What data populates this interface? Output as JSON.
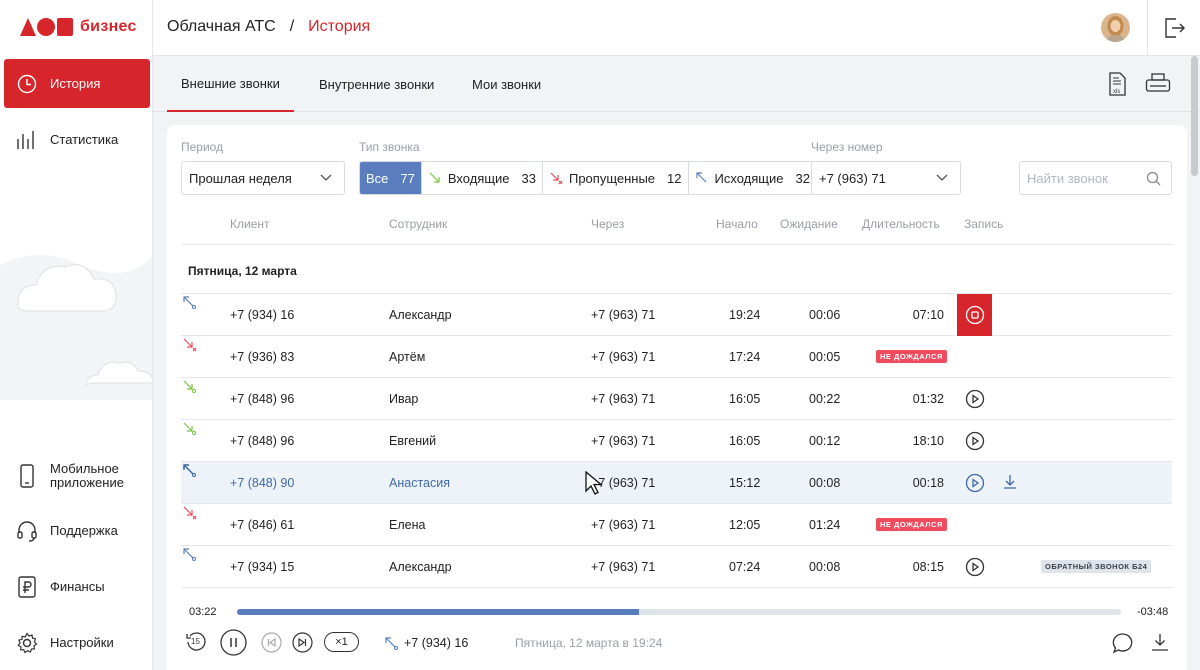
{
  "brand": {
    "logo_text": "бизнес",
    "accent": "#d7252c"
  },
  "sidebar": {
    "items": [
      {
        "label": "История",
        "icon": "clock-icon",
        "active": true
      },
      {
        "label": "Статистика",
        "icon": "bars-chart-icon"
      },
      {
        "label": "Мобильное приложение",
        "icon": "phone-icon"
      },
      {
        "label": "Поддержка",
        "icon": "headset-icon"
      },
      {
        "label": "Финансы",
        "icon": "ruble-icon"
      },
      {
        "label": "Настройки",
        "icon": "gear-icon"
      }
    ]
  },
  "header": {
    "section": "Облачная АТС",
    "separator": "/",
    "page": "История"
  },
  "tabs": [
    "Внешние звонки",
    "Внутренние звонки",
    "Мои звонки"
  ],
  "tools": {
    "export_icon": "xls-export-icon",
    "print_icon": "printer-icon"
  },
  "filters": {
    "period_label": "Период",
    "period_value": "Прошлая неделя",
    "type_label": "Тип звонка",
    "types": [
      {
        "label": "Все",
        "count": "77",
        "active": true
      },
      {
        "label": "Входящие",
        "count": "33"
      },
      {
        "label": "Пропущенные",
        "count": "12"
      },
      {
        "label": "Исходящие",
        "count": "32"
      }
    ],
    "via_label": "Через номер",
    "via_value": "+7 (963) 71",
    "search_placeholder": "Найти звонок"
  },
  "table": {
    "headers": [
      "Клиент",
      "Сотрудник",
      "Через",
      "Начало",
      "Ожидание",
      "Длительность",
      "Запись"
    ],
    "group": "Пятница, 12 марта",
    "rows": [
      {
        "dir": "outgoing",
        "client": "+7 (934) 16",
        "employee": "Александр",
        "via": "+7 (963) 71",
        "start": "19:24",
        "wait": "00:06",
        "duration": "07:10",
        "record": "stop"
      },
      {
        "dir": "missed",
        "client": "+7 (936) 83",
        "employee": "Артём",
        "via": "+7 (963) 71",
        "start": "17:24",
        "wait": "00:05",
        "badge": "НЕ ДОЖДАЛСЯ"
      },
      {
        "dir": "incoming",
        "client": "+7 (848) 96",
        "employee": "Ивар",
        "via": "+7 (963) 71",
        "start": "16:05",
        "wait": "00:22",
        "duration": "01:32",
        "record": "play"
      },
      {
        "dir": "incoming",
        "client": "+7 (848) 96",
        "employee": "Евгений",
        "via": "+7 (963) 71",
        "start": "16:05",
        "wait": "00:12",
        "duration": "18:10",
        "record": "play"
      },
      {
        "dir": "outgoing",
        "client": "+7 (848) 90",
        "employee": "Анастасия",
        "via": "+7 (963) 71",
        "start": "15:12",
        "wait": "00:08",
        "duration": "00:18",
        "record": "play",
        "download": true,
        "highlight": true
      },
      {
        "dir": "missed",
        "client": "+7 (846) 61",
        "employee": "Елена",
        "via": "+7 (963) 71",
        "start": "12:05",
        "wait": "01:24",
        "badge": "НЕ ДОЖДАЛСЯ"
      },
      {
        "dir": "outgoing",
        "client": "+7 (934) 15",
        "employee": "Александр",
        "via": "+7 (963) 71",
        "start": "07:24",
        "wait": "00:08",
        "duration": "08:15",
        "record": "play",
        "tag": "ОБРАТНЫЙ ЗВОНОК Б24"
      }
    ]
  },
  "player": {
    "elapsed": "03:22",
    "remaining": "-03:48",
    "progress": 0.455,
    "rewind_label": "15",
    "speed": "×1",
    "number": "+7 (934) 16",
    "date": "Пятница, 12 марта в 19:24"
  },
  "colors": {
    "incoming": "#7cc242",
    "missed": "#e84a5f",
    "outgoing": "#5a7dbe",
    "highlight": "#5a7dbe"
  }
}
